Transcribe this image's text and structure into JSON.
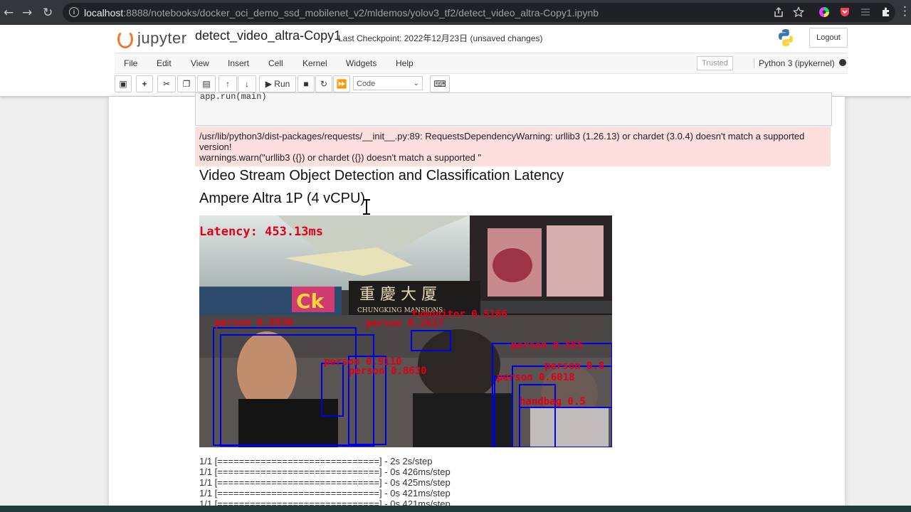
{
  "browser": {
    "url_host": "localhost",
    "url_rest": ":8888/notebooks/docker_oci_demo_ssd_mobilenet_v2/mldemos/yolov3_tf2/detect_video_altra-Copy1.ipynb"
  },
  "header": {
    "logo_text": "jupyter",
    "notebook_title": "detect_video_altra-Copy1",
    "checkpoint": "Last Checkpoint: 2022年12月23日  (unsaved changes)",
    "logout_label": "Logout"
  },
  "menu": {
    "items": [
      "File",
      "Edit",
      "View",
      "Insert",
      "Cell",
      "Kernel",
      "Widgets",
      "Help"
    ],
    "trusted": "Trusted",
    "kernel_name": "Python 3 (ipykernel)"
  },
  "toolbar": {
    "run_label": "Run",
    "cell_type": "Code"
  },
  "cell": {
    "code_partial": "app.run(main)",
    "stderr_line1": "/usr/lib/python3/dist-packages/requests/__init__.py:89: RequestsDependencyWarning: urllib3 (1.26.13) or chardet (3.0.4) doesn't match a supported",
    "stderr_line2": "version!",
    "stderr_line3": "  warnings.warn(\"urllib3 ({}) or chardet ({}) doesn't match a supported \""
  },
  "output": {
    "title": "Video Stream Object Detection and Classification Latency",
    "subtitle": "Ampere Altra 1P (4 vCPU)",
    "latency": "Latency: 453.13ms",
    "detections": [
      "tvmonitor 0.5166",
      "person 0.2617",
      "person 0.9930",
      "person 0.9110",
      "person 0.8630",
      "person 0.6018",
      "person 0.8",
      "person 0.565",
      "handbag 0.5"
    ],
    "sign_text": "CHUNGKING MANSIONS",
    "progress": [
      "1/1 [==============================] - 2s 2s/step",
      "1/1 [==============================] - 0s 426ms/step",
      "1/1 [==============================] - 0s 425ms/step",
      "1/1 [==============================] - 0s 421ms/step",
      "1/1 [==============================] - 0s 421ms/step"
    ]
  }
}
